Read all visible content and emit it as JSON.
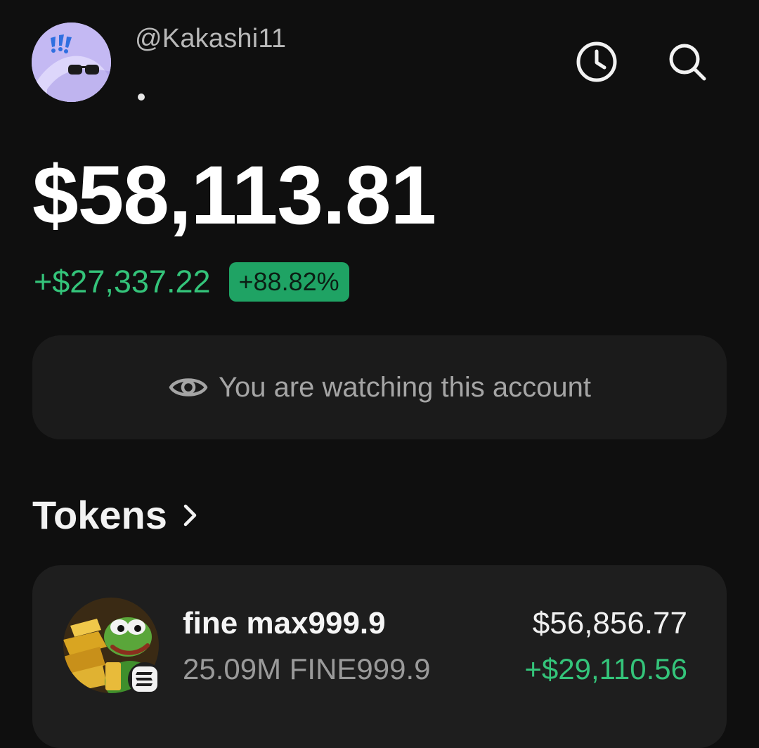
{
  "profile": {
    "username": "@Kakashi11",
    "avatar_icon": "sunglasses-avatar-icon"
  },
  "header": {
    "history_icon": "clock-icon",
    "search_icon": "search-icon"
  },
  "portfolio": {
    "balance": "$58,113.81",
    "change_value": "+$27,337.22",
    "change_percent": "+88.82%"
  },
  "watch_banner": {
    "icon": "eye-icon",
    "text": "You are watching this account"
  },
  "tokens": {
    "title": "Tokens",
    "items": [
      {
        "name": "fine max999.9",
        "amount": "25.09M FINE999.9",
        "value": "$56,856.77",
        "change": "+$29,110.56",
        "logo_icon": "pepe-gold-token-icon",
        "chain_icon": "solana-badge-icon"
      }
    ]
  },
  "colors": {
    "background": "#0f0f0f",
    "positive": "#34c47a",
    "badge": "#1fa364",
    "card": "#1e1e1e"
  }
}
